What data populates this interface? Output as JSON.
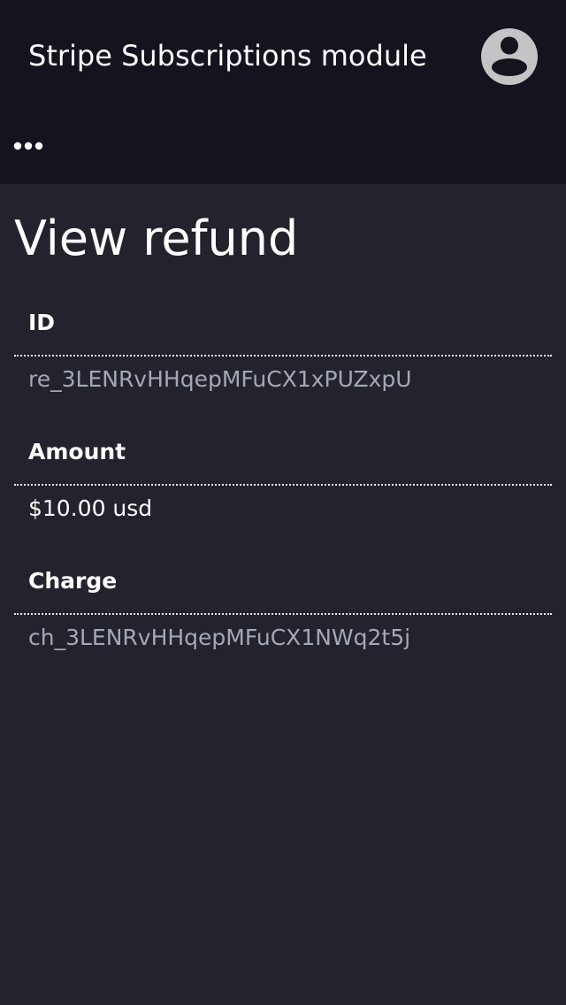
{
  "header": {
    "app_title": "Stripe Subscriptions module",
    "account_icon": "user-circle-icon",
    "menu_icon": "more-horizontal-icon"
  },
  "page": {
    "title": "View refund"
  },
  "fields": [
    {
      "label": "ID",
      "value": "re_3LENRvHHqepMFuCX1xPUZxpU"
    },
    {
      "label": "Amount",
      "value": "$10.00 usd"
    },
    {
      "label": "Charge",
      "value": "ch_3LENRvHHqepMFuCX1NWq2t5j"
    }
  ],
  "colors": {
    "header_bg": "#13141d",
    "page_bg": "#22232c",
    "text": "#ffffff",
    "muted_text": "#a4a8b6",
    "avatar": "#c4c4c6"
  }
}
